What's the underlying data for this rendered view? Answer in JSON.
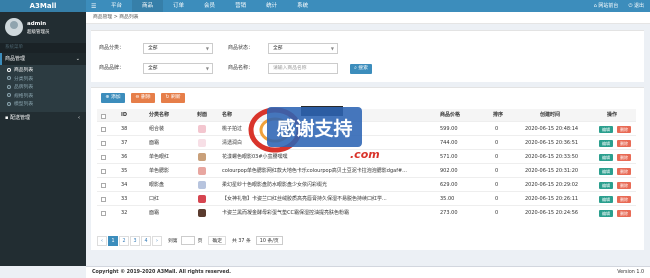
{
  "app": {
    "brand": "A3Mall"
  },
  "topnav": {
    "items": [
      "平台",
      "商品",
      "订单",
      "会员",
      "营销",
      "统计",
      "系统"
    ],
    "active_index": 1,
    "right_links": [
      "网站前台",
      "退出"
    ]
  },
  "sidebar": {
    "user_name": "admin",
    "user_role": "超级管理员",
    "section_label": "系统菜单",
    "menu_goods": "商品管理",
    "sub_items": [
      "商品列表",
      "分类列表",
      "品牌列表",
      "规格列表",
      "模型列表"
    ],
    "sub_active_index": 0,
    "menu_delivery": "配送管理"
  },
  "breadcrumb": "商品管理 > 商品列表",
  "filters": {
    "category_label": "商品分类：",
    "category_value": "全部",
    "status_label": "商品状态：",
    "status_value": "全部",
    "brand_label": "商品品牌：",
    "brand_value": "全部",
    "name_label": "商品名称：",
    "name_placeholder": "请输入商品名称",
    "search_btn": "搜索"
  },
  "toolbar": {
    "add": "添加",
    "delete": "删除",
    "refresh": "刷新"
  },
  "table": {
    "headers": [
      "ID",
      "分类名称",
      "封面",
      "名称",
      "商品价格",
      "排序",
      "创建时间",
      "操作"
    ],
    "rows": [
      {
        "id": "38",
        "category": "组合装",
        "name": "桃子拍过",
        "price": "599.00",
        "sort": "0",
        "time": "2020-06-15 20:48:14",
        "thumb_color": "#f3c6cf"
      },
      {
        "id": "37",
        "category": "面霜",
        "name": "清透润白",
        "price": "744.00",
        "sort": "0",
        "time": "2020-06-15 20:36:51",
        "thumb_color": "#f7dfe6"
      },
      {
        "id": "36",
        "category": "单色眼红",
        "name": "花漾螺色眼影03#小蛮腰嘿嘿",
        "price": "571.00",
        "sort": "0",
        "time": "2020-06-15 20:33:50",
        "thumb_color": "#c9a07a"
      },
      {
        "id": "35",
        "category": "单色腮影",
        "name": "colourpop单色腮影网红款大地色卡乐colourpop高贝土豆泥卡拉泡泡腮影dgaf#...",
        "price": "902.00",
        "sort": "0",
        "time": "2020-06-15 20:31:20",
        "thumb_color": "#e8a6a0"
      },
      {
        "id": "34",
        "category": "眼影盘",
        "name": "柔幻星紗十色眼影盘防水眼影盘少女依闪彩缀光",
        "price": "629.00",
        "sort": "0",
        "time": "2020-06-15 20:29:02",
        "thumb_color": "#b7c4de"
      },
      {
        "id": "33",
        "category": "口红",
        "name": "【女神礼物】卡姿兰口红丝绒胶质高亮唇膏持久保湿不易脱色持续口红学...",
        "price": "35.00",
        "sort": "0",
        "time": "2020-06-15 20:26:11",
        "thumb_color": "#d64550"
      },
      {
        "id": "32",
        "category": "面霜",
        "name": "卡姿兰黑而凝金酵母彩蛋气垫CC霜保湿控油提亮肤色粉霜",
        "price": "273.00",
        "sort": "0",
        "time": "2020-06-15 20:24:56",
        "thumb_color": "#5a3b2e"
      }
    ],
    "edit_label": "编辑",
    "delete_label": "删除"
  },
  "pagination": {
    "pages": [
      "1",
      "2",
      "3",
      "4"
    ],
    "current": "1",
    "next": "›",
    "goto_label": "到第",
    "page_unit": "页",
    "confirm": "确定",
    "total": "共 37 条",
    "per_page": "10 条/页"
  },
  "watermark": {
    "text": "感谢支持",
    "domain_text": ".com"
  },
  "footer": {
    "copyright": "Copyright © 2019-2020 A3Mall. All rights reserved.",
    "version": "Version 1.0"
  },
  "colors": {
    "primary": "#3c8dbc",
    "sidebar": "#222d32",
    "edit": "#2b9f8e",
    "delete": "#e86a55"
  }
}
